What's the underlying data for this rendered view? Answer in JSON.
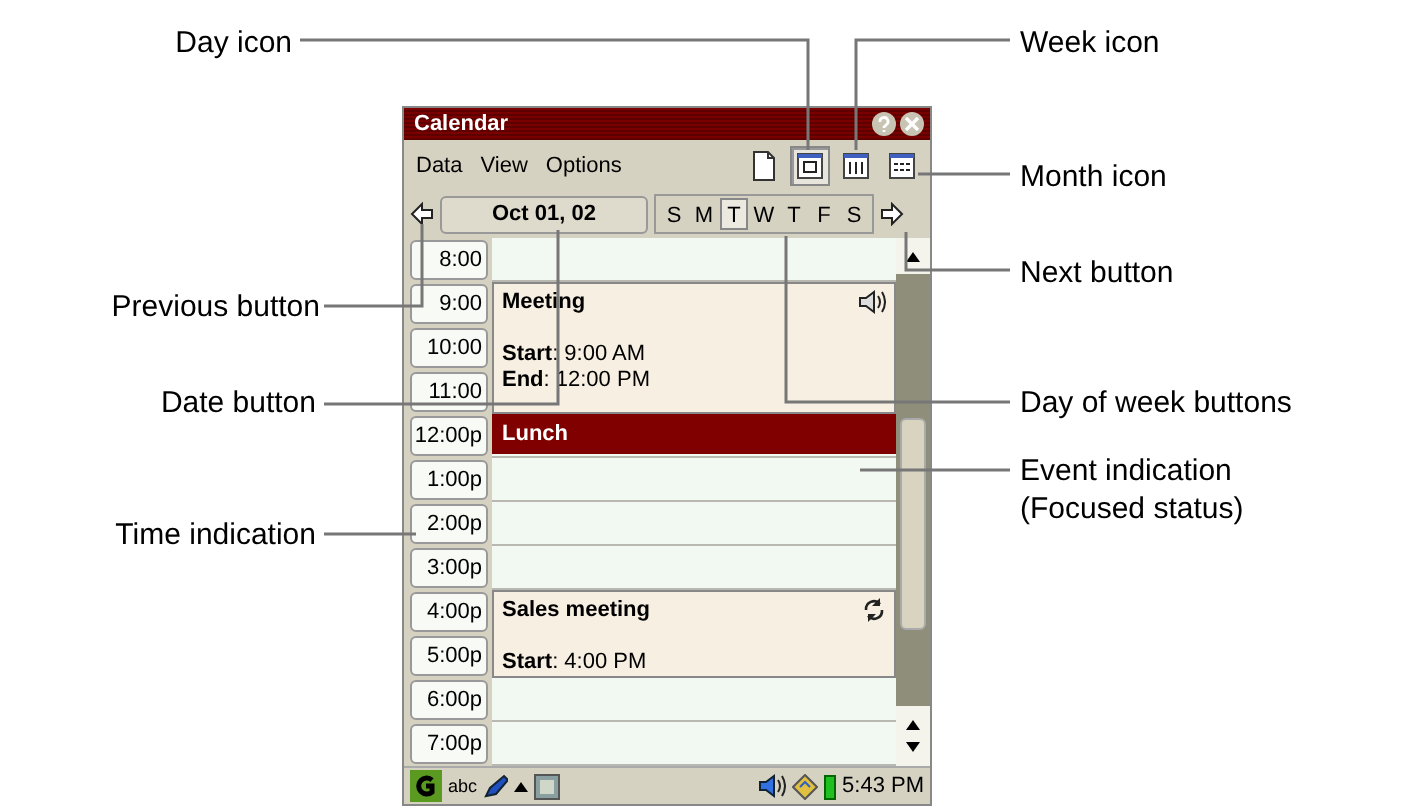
{
  "window": {
    "title": "Calendar"
  },
  "menu": [
    "Data",
    "View",
    "Options"
  ],
  "view_buttons": [
    {
      "kind": "new",
      "selected": false
    },
    {
      "kind": "day",
      "selected": true
    },
    {
      "kind": "week",
      "selected": false
    },
    {
      "kind": "month",
      "selected": false
    }
  ],
  "date_button": "Oct 01, 02",
  "weekdays": [
    {
      "label": "S",
      "selected": false
    },
    {
      "label": "M",
      "selected": false
    },
    {
      "label": "T",
      "selected": true
    },
    {
      "label": "W",
      "selected": false
    },
    {
      "label": "T",
      "selected": false
    },
    {
      "label": "F",
      "selected": false
    },
    {
      "label": "S",
      "selected": false
    }
  ],
  "times": [
    "8:00",
    "9:00",
    "10:00",
    "11:00",
    "12:00p",
    "1:00p",
    "2:00p",
    "3:00p",
    "4:00p",
    "5:00p",
    "6:00p",
    "7:00p"
  ],
  "events": [
    {
      "kind": "alarm",
      "title": "Meeting",
      "details": [
        "**Start**: 9:00 AM",
        "**End**: 12:00 PM"
      ],
      "focused": false
    },
    {
      "kind": "plain",
      "title": "Lunch",
      "focused": true
    },
    {
      "kind": "repeat",
      "title": "Sales meeting",
      "details": [
        "**Start**: 4:00 PM"
      ],
      "focused": false
    }
  ],
  "taskbar": {
    "input_mode": "abc",
    "clock": "5:43 PM"
  },
  "callouts": [
    "Day icon",
    "Week icon",
    "Month icon",
    "Next button",
    "Previous button",
    "Date button",
    "Day of week buttons",
    "Event indication\n(Focused status)",
    "Time indication"
  ]
}
